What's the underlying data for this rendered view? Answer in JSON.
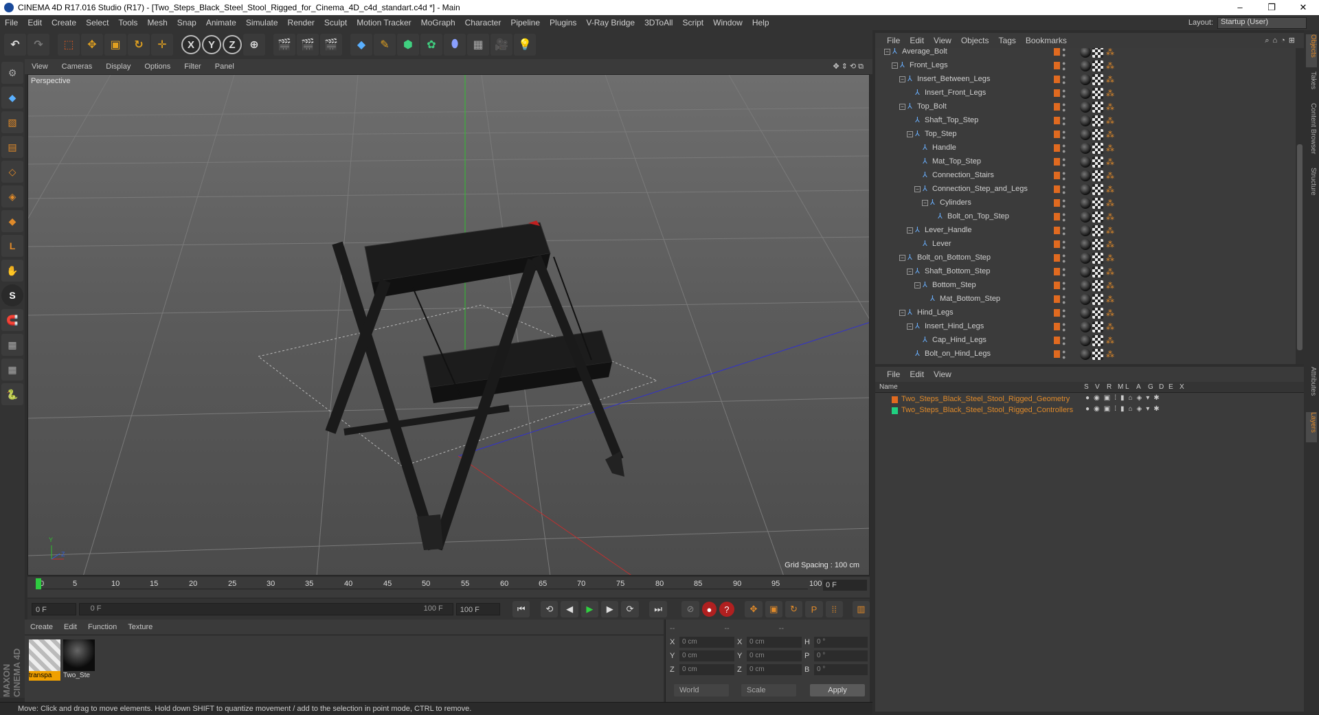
{
  "window": {
    "title": "CINEMA 4D R17.016 Studio (R17) - [Two_Steps_Black_Steel_Stool_Rigged_for_Cinema_4D_c4d_standart.c4d *] - Main",
    "controls": [
      "–",
      "❐",
      "✕"
    ]
  },
  "menubar": {
    "items": [
      "File",
      "Edit",
      "Create",
      "Select",
      "Tools",
      "Mesh",
      "Snap",
      "Animate",
      "Simulate",
      "Render",
      "Sculpt",
      "Motion Tracker",
      "MoGraph",
      "Character",
      "Pipeline",
      "Plugins",
      "V-Ray Bridge",
      "3DToAll",
      "Script",
      "Window",
      "Help"
    ],
    "layout_label": "Layout:",
    "layout_value": "Startup (User)"
  },
  "toolbar": {
    "axis_labels": [
      "X",
      "Y",
      "Z"
    ]
  },
  "viewport": {
    "menu": [
      "View",
      "Cameras",
      "Display",
      "Options",
      "Filter",
      "Panel"
    ],
    "camera_label": "Perspective",
    "grid_spacing": "Grid Spacing : 100 cm",
    "axis_gizmo": {
      "y": "Y",
      "z": "Z"
    }
  },
  "timeline": {
    "ticks": [
      "0",
      "5",
      "10",
      "15",
      "20",
      "25",
      "30",
      "35",
      "40",
      "45",
      "50",
      "55",
      "60",
      "65",
      "70",
      "75",
      "80",
      "85",
      "90",
      "95",
      "100"
    ],
    "current_frame_field": "0 F",
    "start_field": "0 F",
    "range_start": "0 F",
    "range_end": "100 F",
    "end_field": "100 F"
  },
  "material_manager": {
    "menu": [
      "Create",
      "Edit",
      "Function",
      "Texture"
    ],
    "materials": [
      {
        "name": "transpa"
      },
      {
        "name": "Two_Ste"
      }
    ]
  },
  "coordinates": {
    "header": [
      "--",
      "--",
      "--"
    ],
    "rows": [
      {
        "a": "X",
        "av": "0 cm",
        "b": "X",
        "bv": "0 cm",
        "c": "H",
        "cv": "0 °"
      },
      {
        "a": "Y",
        "av": "0 cm",
        "b": "Y",
        "bv": "0 cm",
        "c": "P",
        "cv": "0 °"
      },
      {
        "a": "Z",
        "av": "0 cm",
        "b": "Z",
        "bv": "0 cm",
        "c": "B",
        "cv": "0 °"
      }
    ],
    "world": "World",
    "scale": "Scale",
    "apply": "Apply"
  },
  "statusbar": {
    "text": "Move: Click and drag to move elements. Hold down SHIFT to quantize movement / add to the selection in point mode, CTRL to remove."
  },
  "object_manager": {
    "menu": [
      "File",
      "Edit",
      "View",
      "Objects",
      "Tags",
      "Bookmarks"
    ],
    "objects": [
      {
        "name": "Average_Bolt",
        "depth": 3
      },
      {
        "name": "Front_Legs",
        "depth": 4
      },
      {
        "name": "Insert_Between_Legs",
        "depth": 5
      },
      {
        "name": "Insert_Front_Legs",
        "depth": 6
      },
      {
        "name": "Top_Bolt",
        "depth": 5
      },
      {
        "name": "Shaft_Top_Step",
        "depth": 6
      },
      {
        "name": "Top_Step",
        "depth": 6
      },
      {
        "name": "Handle",
        "depth": 7
      },
      {
        "name": "Mat_Top_Step",
        "depth": 7
      },
      {
        "name": "Connection_Stairs",
        "depth": 7
      },
      {
        "name": "Connection_Step_and_Legs",
        "depth": 7
      },
      {
        "name": "Cylinders",
        "depth": 8
      },
      {
        "name": "Bolt_on_Top_Step",
        "depth": 9
      },
      {
        "name": "Lever_Handle",
        "depth": 6
      },
      {
        "name": "Lever",
        "depth": 7
      },
      {
        "name": "Bolt_on_Bottom_Step",
        "depth": 5
      },
      {
        "name": "Shaft_Bottom_Step",
        "depth": 6
      },
      {
        "name": "Bottom_Step",
        "depth": 7
      },
      {
        "name": "Mat_Bottom_Step",
        "depth": 8
      },
      {
        "name": "Hind_Legs",
        "depth": 5
      },
      {
        "name": "Insert_Hind_Legs",
        "depth": 6
      },
      {
        "name": "Cap_Hind_Legs",
        "depth": 7
      },
      {
        "name": "Bolt_on_Hind_Legs",
        "depth": 6
      }
    ]
  },
  "layer_manager": {
    "menu": [
      "File",
      "Edit",
      "View"
    ],
    "columns": [
      "Name",
      "S",
      "V",
      "R",
      "M",
      "L",
      "A",
      "G",
      "D",
      "E",
      "X"
    ],
    "layers": [
      {
        "name": "Two_Steps_Black_Steel_Stool_Rigged_Geometry",
        "color": "#e06a20"
      },
      {
        "name": "Two_Steps_Black_Steel_Stool_Rigged_Controllers",
        "color": "#20d080"
      }
    ]
  },
  "right_tabs": [
    "Objects",
    "Takes",
    "Content Browser",
    "Structure",
    "Attributes",
    "Layers"
  ]
}
